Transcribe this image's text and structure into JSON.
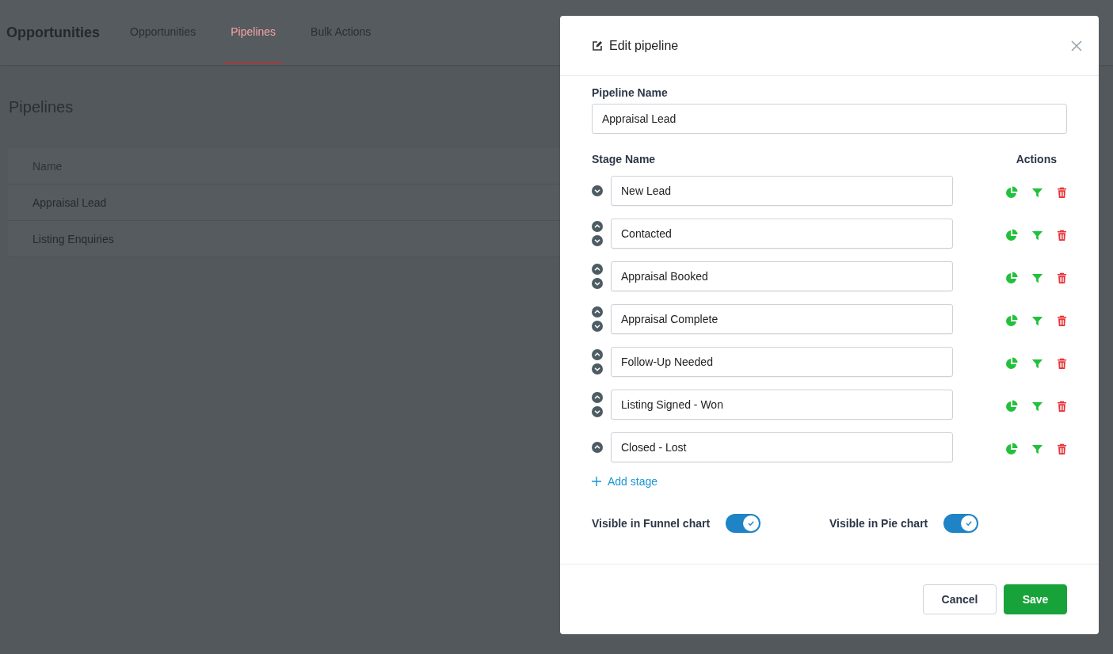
{
  "page": {
    "title": "Opportunities",
    "tabs": [
      {
        "label": "Opportunities",
        "selected": false
      },
      {
        "label": "Pipelines",
        "selected": true
      },
      {
        "label": "Bulk Actions",
        "selected": false
      }
    ],
    "heading": "Pipelines",
    "table": {
      "columns": [
        "Name"
      ],
      "rows": [
        [
          "Appraisal Lead"
        ],
        [
          "Listing Enquiries"
        ]
      ]
    }
  },
  "dialog": {
    "title": "Edit pipeline",
    "pipeline_name_label": "Pipeline Name",
    "pipeline_name": "Appraisal Lead",
    "stage_name_label": "Stage Name",
    "actions_label": "Actions",
    "stages": [
      {
        "name": "New Lead",
        "can_move_up": false,
        "can_move_down": true
      },
      {
        "name": "Contacted",
        "can_move_up": true,
        "can_move_down": true
      },
      {
        "name": "Appraisal Booked",
        "can_move_up": true,
        "can_move_down": true
      },
      {
        "name": "Appraisal Complete",
        "can_move_up": true,
        "can_move_down": true
      },
      {
        "name": "Follow-Up Needed",
        "can_move_up": true,
        "can_move_down": true
      },
      {
        "name": "Listing Signed - Won",
        "can_move_up": true,
        "can_move_down": true
      },
      {
        "name": "Closed - Lost",
        "can_move_up": true,
        "can_move_down": false
      }
    ],
    "add_stage": "Add stage",
    "toggles": [
      {
        "label": "Visible in Funnel chart",
        "on": true
      },
      {
        "label": "Visible in Pie chart",
        "on": true
      }
    ],
    "buttons": [
      {
        "label": "Cancel",
        "kind": "secondary"
      },
      {
        "label": "Save",
        "kind": "primary"
      }
    ]
  }
}
